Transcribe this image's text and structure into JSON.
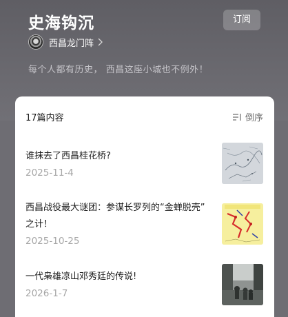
{
  "header": {
    "title": "史海钩沉",
    "subscribe_label": "订阅",
    "author_name": "西昌龙门阵",
    "description": "每个人都有历史， 西昌这座小城也不例外！"
  },
  "list": {
    "count_label": "17篇内容",
    "sort_label": "倒序",
    "items": [
      {
        "title": "谁抹去了西昌桂花桥?",
        "date": "2025-11-4"
      },
      {
        "title_line1": "西昌战役最大谜团：参谋长罗列的“金蝉脱壳”",
        "title_line2": "之计！",
        "date": "2025-10-25"
      },
      {
        "title": "一代枭雄凉山邓秀廷的传说!",
        "date": "2026-1-7"
      }
    ]
  },
  "colors": {
    "hero_bg": "#646369",
    "card_bg": "#ffffff",
    "text_primary": "#1a1a1a",
    "text_secondary": "#a6a6a6"
  }
}
